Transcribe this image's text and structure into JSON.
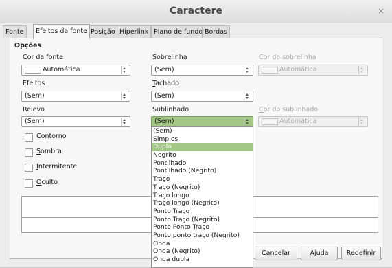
{
  "window": {
    "title": "Caractere",
    "close_glyph": "×"
  },
  "tabs": [
    {
      "label": "Fonte"
    },
    {
      "label": "Efeitos da fonte"
    },
    {
      "label": "Posição"
    },
    {
      "label": "Hiperlink"
    },
    {
      "label": "Plano de fundo"
    },
    {
      "label": "Bordas"
    }
  ],
  "section": {
    "title": "Opções"
  },
  "font_color": {
    "label": "Cor da fonte",
    "value": "Automática"
  },
  "overline": {
    "label": "Sobrelinha",
    "value": "(Sem)"
  },
  "overline_color": {
    "label": "Cor da sobrelinha",
    "value": "Automática"
  },
  "effects": {
    "label": "Efeitos",
    "value": "(Sem)"
  },
  "strikethrough": {
    "label_underline_char": "T",
    "label_rest": "achado",
    "value": "(Sem)"
  },
  "relief": {
    "label": "Relevo",
    "value": "(Sem)"
  },
  "underline": {
    "label": "Sublinhado",
    "value": "(Sem)"
  },
  "underline_color": {
    "label_underline_char": "C",
    "label_rest": "or do sublinhado",
    "value": "Automática"
  },
  "checkboxes": {
    "outline": {
      "pre": "Co",
      "u": "n",
      "post": "torno",
      "checked": false
    },
    "shadow": {
      "pre": "",
      "u": "S",
      "post": "ombra",
      "checked": false
    },
    "blinking": {
      "pre": "",
      "u": "I",
      "post": "ntermitente",
      "checked": false
    },
    "hidden": {
      "pre": "",
      "u": "O",
      "post": "culto",
      "checked": false
    }
  },
  "buttons": {
    "cancel": {
      "u": "C",
      "post": "ancelar"
    },
    "help": {
      "pre": "Aj",
      "u": "u",
      "post": "da"
    },
    "reset": {
      "u": "R",
      "post": "edefinir"
    }
  },
  "underline_options": [
    "(Sem)",
    "Simples",
    "Duplo",
    "Negrito",
    "Pontilhado",
    "Pontilhado (Negrito)",
    "Traço",
    "Traço (Negrito)",
    "Traço longo",
    "Traço longo (Negrito)",
    "Ponto Traço",
    "Ponto Traço (Negrito)",
    "Ponto Ponto Traço",
    "Ponto ponto traço (Negrito)",
    "Onda",
    "Onda (Negrito)",
    "Onda dupla"
  ],
  "underline_highlighted_option": "Duplo",
  "colors": {
    "highlight": "#a3c785",
    "window_bg": "#ececec",
    "panel_bg": "#f7f7f7"
  }
}
